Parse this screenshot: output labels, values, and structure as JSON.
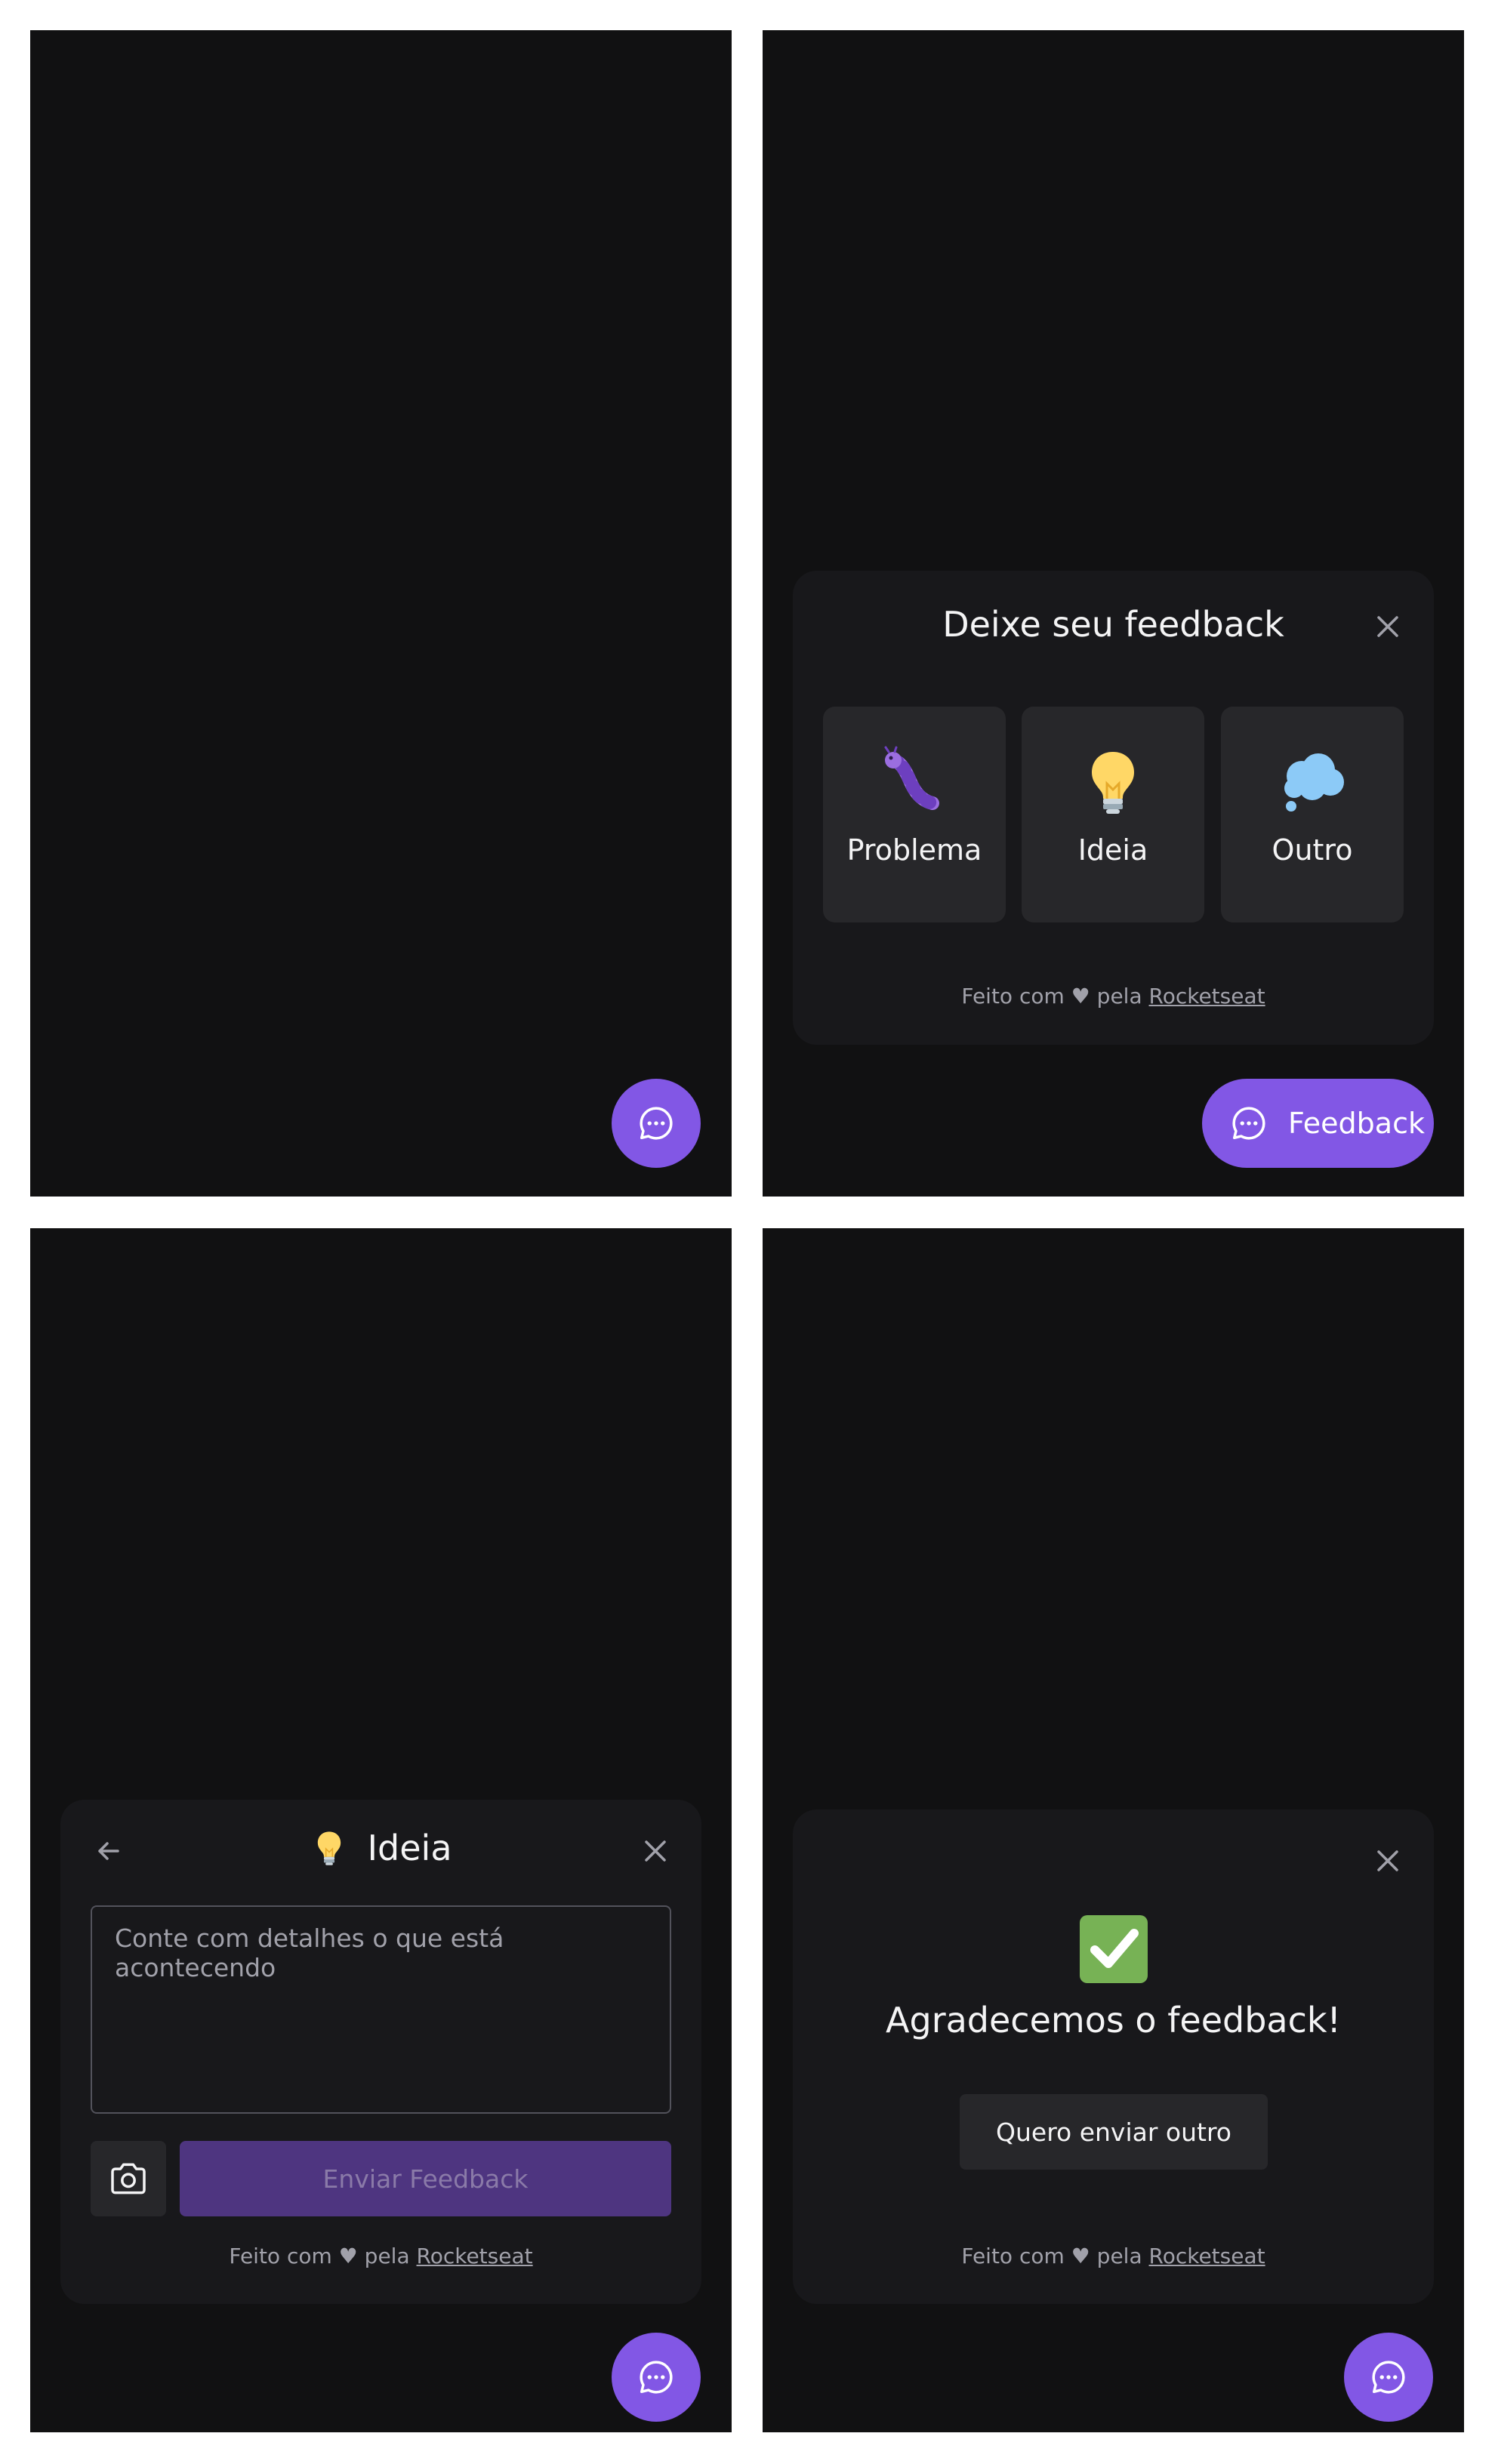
{
  "colors": {
    "accent": "#8257e5",
    "background": "#111112",
    "card": "#18181b",
    "surface": "#27272a",
    "muted_text": "#a1a1aa"
  },
  "screen1": {
    "fab_icon": "chat-bubble-icon"
  },
  "screen2": {
    "title": "Deixe seu feedback",
    "options": [
      {
        "label": "Problema",
        "icon": "bug-icon"
      },
      {
        "label": "Ideia",
        "icon": "lightbulb-icon"
      },
      {
        "label": "Outro",
        "icon": "thought-cloud-icon"
      }
    ],
    "fab_label": "Feedback"
  },
  "screen3": {
    "title": "Ideia",
    "placeholder": "Conte com detalhes o que está acontecendo",
    "send_label": "Enviar Feedback"
  },
  "screen4": {
    "title": "Agradecemos o feedback!",
    "again_label": "Quero enviar outro"
  },
  "footer": {
    "prefix": "Feito com ♥ pela",
    "link": "Rocketseat"
  }
}
